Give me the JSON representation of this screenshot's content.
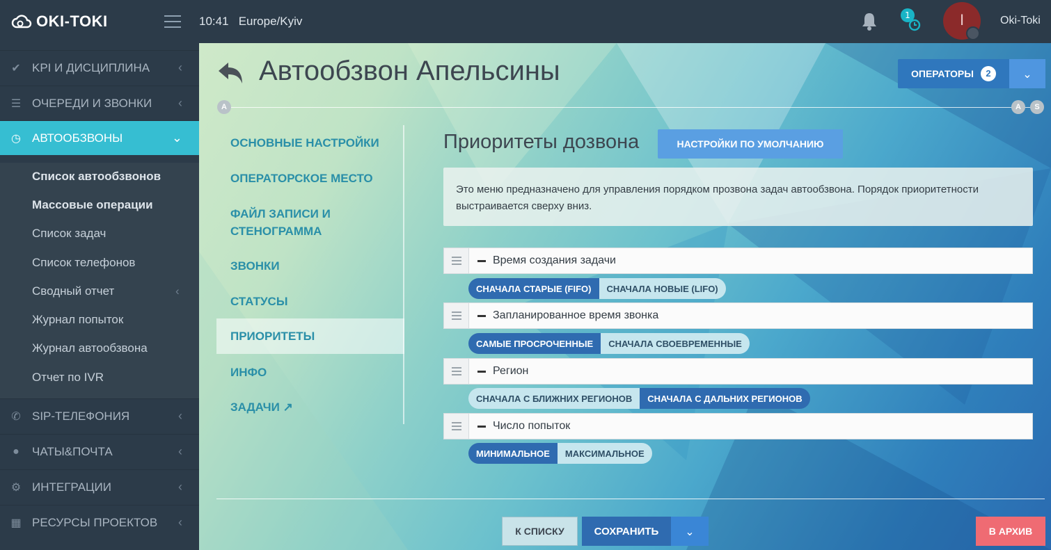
{
  "header": {
    "logo_text": "OKI-TOKI",
    "time": "10:41",
    "timezone": "Europe/Kyiv",
    "notification_count": "1",
    "avatar_letter": "I",
    "username": "Oki-Toki"
  },
  "sidebar": {
    "items": [
      {
        "label": "KPI И ДИСЦИПЛИНА",
        "icon": "check-icon"
      },
      {
        "label": "ОЧЕРЕДИ И ЗВОНКИ",
        "icon": "list-icon"
      },
      {
        "label": "АВТООБЗВОНЫ",
        "icon": "clock-icon"
      },
      {
        "label": "SIP-ТЕЛЕФОНИЯ",
        "icon": "phone-icon"
      },
      {
        "label": "ЧАТЫ&ПОЧТА",
        "icon": "chat-icon"
      },
      {
        "label": "ИНТЕГРАЦИИ",
        "icon": "gears-icon"
      },
      {
        "label": "РЕСУРСЫ ПРОЕКТОВ",
        "icon": "grid-icon"
      }
    ],
    "subitems": [
      {
        "label": "Список автообзвонов"
      },
      {
        "label": "Массовые операции"
      },
      {
        "label": "Список задач"
      },
      {
        "label": "Список телефонов"
      },
      {
        "label": "Сводный отчет"
      },
      {
        "label": "Журнал попыток"
      },
      {
        "label": "Журнал автообзвона"
      },
      {
        "label": "Отчет по IVR"
      }
    ]
  },
  "main": {
    "title": "Автообзвон Апельсины",
    "tag_a": "A",
    "tag_s": "S",
    "operators_label": "ОПЕРАТОРЫ",
    "operators_count": "2",
    "tabs": [
      {
        "label": "ОСНОВНЫЕ НАСТРОЙКИ"
      },
      {
        "label": "ОПЕРАТОРСКОЕ МЕСТО"
      },
      {
        "label": "ФАЙЛ ЗАПИСИ И СТЕНОГРАММА"
      },
      {
        "label": "ЗВОНКИ"
      },
      {
        "label": "СТАТУСЫ"
      },
      {
        "label": "ПРИОРИТЕТЫ"
      },
      {
        "label": "ИНФО"
      },
      {
        "label": "ЗАДАЧИ"
      }
    ],
    "section_title": "Приоритеты дозвона",
    "default_button": "НАСТРОЙКИ ПО УМОЛЧАНИЮ",
    "info_text": "Это меню предназначено для управления порядком прозвона задач автообзвона. Порядок приоритетности выстраивается сверху вниз.",
    "priorities": [
      {
        "label": "Время создания задачи",
        "options": [
          "СНАЧАЛА СТАРЫЕ (FIFO)",
          "СНАЧАЛА НОВЫЕ (LIFO)"
        ],
        "selected": 0
      },
      {
        "label": "Запланированное время звонка",
        "options": [
          "САМЫЕ ПРОСРОЧЕННЫЕ",
          "СНАЧАЛА СВОЕВРЕМЕННЫЕ"
        ],
        "selected": 0
      },
      {
        "label": "Регион",
        "options": [
          "СНАЧАЛА С БЛИЖНИХ РЕГИОНОВ",
          "СНАЧАЛА С ДАЛЬНИХ РЕГИОНОВ"
        ],
        "selected": 1
      },
      {
        "label": "Число попыток",
        "options": [
          "МИНИМАЛЬНОЕ",
          "МАКСИМАЛЬНОЕ"
        ],
        "selected": 0
      }
    ],
    "footer": {
      "to_list": "К СПИСКУ",
      "save": "СОХРАНИТЬ",
      "archive": "В АРХИВ"
    }
  },
  "colors": {
    "active_nav": "#36bed2",
    "primary": "#2f6bb0",
    "danger": "#ef6b73"
  }
}
